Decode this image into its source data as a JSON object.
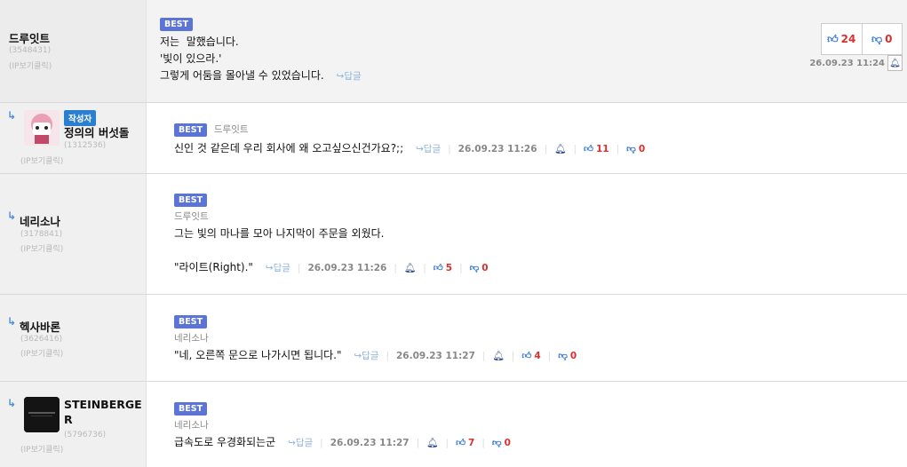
{
  "comments": [
    {
      "nick": "드루잇트",
      "uid": "(3548431)",
      "ip_label": "(IP보기클릭)",
      "best": "BEST",
      "lines": [
        "저는  말했습니다.",
        "'빛이 있으라.'",
        "그렇게 어둠을 몰아낼 수 있었습니다."
      ],
      "reply": "↪답글",
      "date": "26.09.23 11:24",
      "up": "24",
      "down": "0"
    },
    {
      "nick": "정의의 버섯돌",
      "author_badge": "작성자",
      "uid": "(1312536)",
      "ip_label": "(IP보기클릭)",
      "best": "BEST",
      "target": "드루잇트",
      "text": "신인 것 같은데 우리 회사에 왜 오고싶으신건가요?;;",
      "reply": "↪답글",
      "date": "26.09.23 11:26",
      "up": "11",
      "down": "0"
    },
    {
      "nick": "네리소나",
      "uid": "(3178841)",
      "ip_label": "(IP보기클릭)",
      "best": "BEST",
      "target": "드루잇트",
      "line1": "그는 빛의 마나를 모아 나지막이 주문을 외웠다.",
      "line2": "\"라이트(Right).\"",
      "reply": "↪답글",
      "date": "26.09.23 11:26",
      "up": "5",
      "down": "0"
    },
    {
      "nick": "헥사바론",
      "uid": "(3626416)",
      "ip_label": "(IP보기클릭)",
      "best": "BEST",
      "target": "네리소나",
      "text": "\"네, 오른쪽 문으로 나가시면 됩니다.\"",
      "reply": "↪답글",
      "date": "26.09.23 11:27",
      "up": "4",
      "down": "0"
    },
    {
      "nick_line1": "STEINBERGE",
      "nick_line2": "R",
      "uid": "(5796736)",
      "ip_label": "(IP보기클릭)",
      "best": "BEST",
      "target": "네리소나",
      "text": "급속도로 우경화되는군",
      "reply": "↪답글",
      "date": "26.09.23 11:27",
      "up": "7",
      "down": "0"
    }
  ],
  "icons": {
    "reply_arrow": "reply-arrow-icon",
    "thumb_up": "thumbs-up-icon",
    "thumb_down": "thumbs-down-icon",
    "bell": "bell-icon"
  },
  "colors": {
    "best_badge": "#5b74d6",
    "author_badge": "#2b7fd1",
    "vote_count": "#d93030",
    "vote_icon": "#3a7bd5"
  }
}
